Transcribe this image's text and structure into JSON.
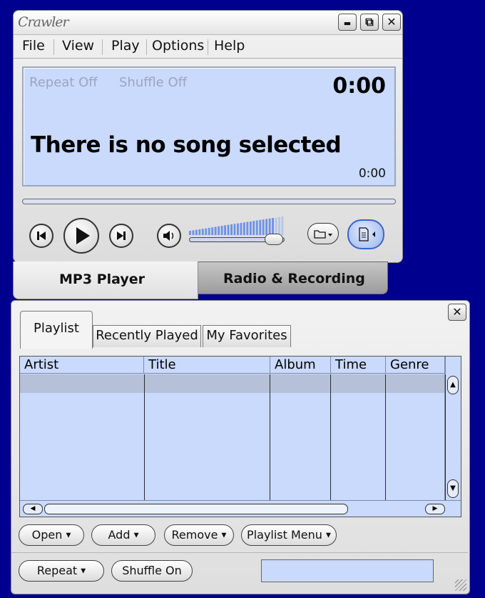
{
  "app": {
    "logo": "Crawler"
  },
  "window_controls": {
    "minimize": "▬",
    "restore": "⧉",
    "close": "✕"
  },
  "menu": [
    {
      "label": "File"
    },
    {
      "label": "View"
    },
    {
      "label": "Play"
    },
    {
      "label": "Options"
    },
    {
      "label": "Help"
    }
  ],
  "display": {
    "repeat_status": "Repeat Off",
    "shuffle_status": "Shuffle Off",
    "elapsed": "0:00",
    "song": "There is no song selected",
    "duration": "0:00"
  },
  "player_tabs": {
    "mp3": "MP3 Player",
    "radio": "Radio & Recording"
  },
  "volume": {
    "level": 0.9
  },
  "playlist": {
    "close": "✕",
    "tabs": [
      {
        "label": "Playlist"
      },
      {
        "label": "Recently Played"
      },
      {
        "label": "My Favorites"
      }
    ],
    "columns": [
      {
        "label": "Artist"
      },
      {
        "label": "Title"
      },
      {
        "label": "Album"
      },
      {
        "label": "Time"
      },
      {
        "label": "Genre"
      }
    ],
    "buttons": {
      "open": "Open",
      "add": "Add",
      "remove": "Remove",
      "menu": "Playlist Menu",
      "repeat": "Repeat",
      "shuffle": "Shuffle On"
    }
  },
  "colors": {
    "accent": "#c9dafd",
    "background": "#00008e"
  }
}
